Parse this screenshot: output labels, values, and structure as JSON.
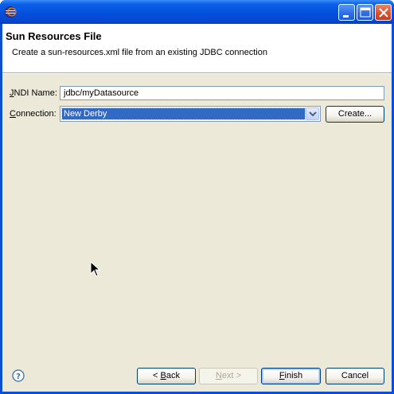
{
  "window": {
    "title": "",
    "controls": {
      "minimize_icon": "minimize-icon",
      "maximize_icon": "maximize-icon",
      "close_icon": "close-icon"
    }
  },
  "header": {
    "title": "Sun Resources File",
    "description": "Create a sun-resources.xml file from an existing JDBC connection"
  },
  "form": {
    "jndi_label_mnemonic": "J",
    "jndi_label_rest": "NDI Name:",
    "jndi_value": "jdbc/myDatasource",
    "connection_label_mnemonic": "C",
    "connection_label_rest": "onnection:",
    "connection_value": "New Derby",
    "create_button": "Create..."
  },
  "footer": {
    "back_prefix": "< ",
    "back_mnemonic": "B",
    "back_rest": "ack",
    "next_mnemonic": "N",
    "next_rest": "ext >",
    "finish_mnemonic": "F",
    "finish_rest": "inish",
    "cancel_label": "Cancel"
  },
  "colors": {
    "titlebar": "#0a5fe8",
    "dialog_background": "#ece9d8",
    "selection": "#316ac5"
  }
}
